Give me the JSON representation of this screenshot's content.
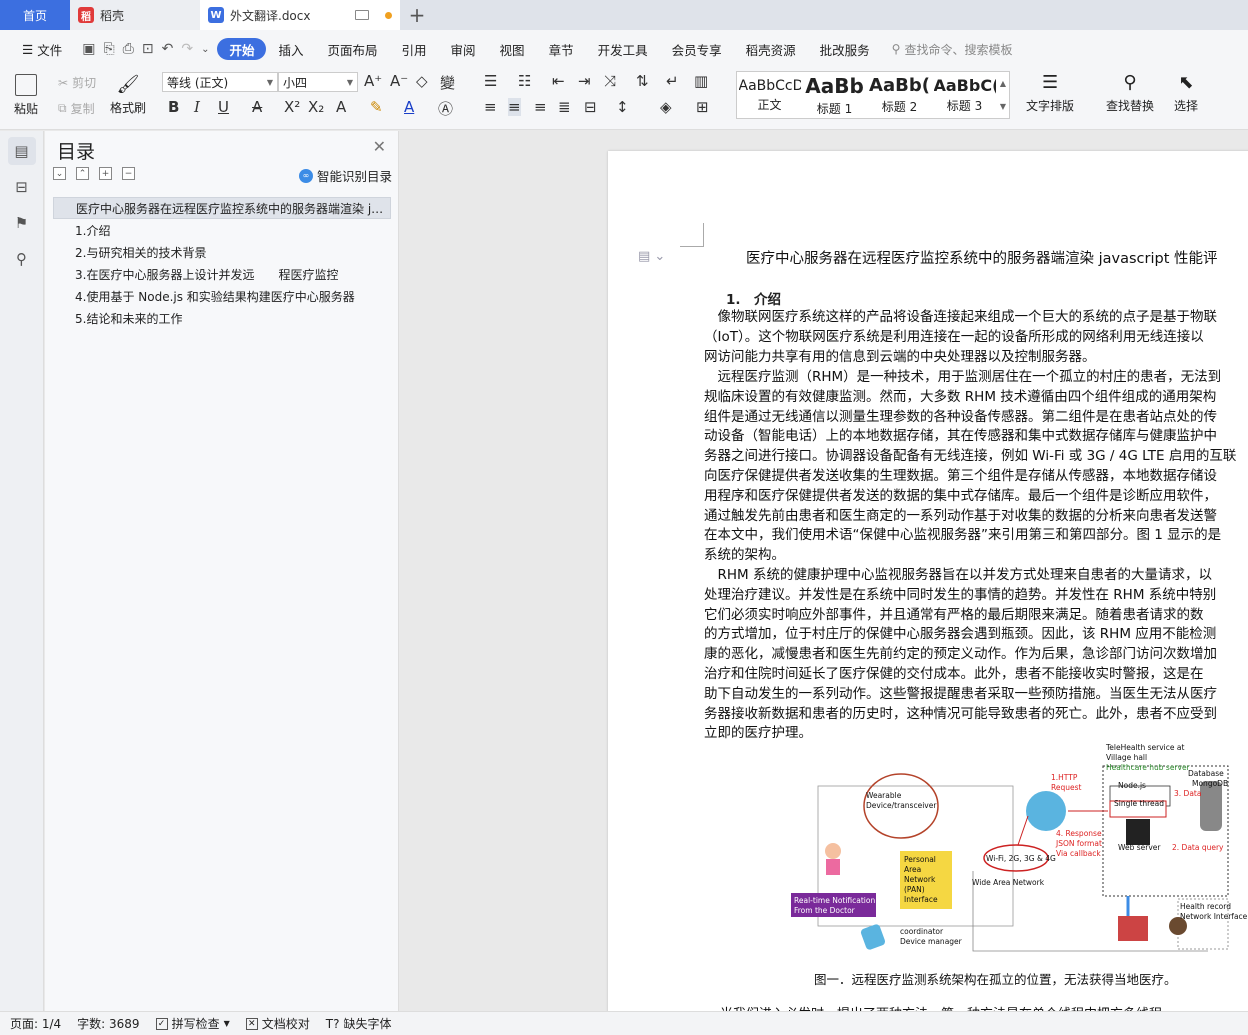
{
  "tabs": {
    "home": "首页",
    "daoke": "稻壳",
    "doc": "外文翻译.docx"
  },
  "menu": {
    "file": "文件",
    "items": [
      "开始",
      "插入",
      "页面布局",
      "引用",
      "审阅",
      "视图",
      "章节",
      "开发工具",
      "会员专享",
      "稻壳资源",
      "批改服务"
    ],
    "search": "查找命令、搜索模板"
  },
  "ribbon": {
    "paste": "粘贴",
    "cut": "剪切",
    "copy": "复制",
    "format_painter": "格式刷",
    "font": "等线 (正文)",
    "size": "小四",
    "styles": [
      {
        "preview": "AaBbCcD",
        "name": "正文"
      },
      {
        "preview": "AaBb",
        "name": "标题 1"
      },
      {
        "preview": "AaBb(",
        "name": "标题 2"
      },
      {
        "preview": "AaBbC(",
        "name": "标题 3"
      }
    ],
    "text_layout": "文字排版",
    "find_replace": "查找替换",
    "select": "选择"
  },
  "toc": {
    "title": "目录",
    "smart": "智能识别目录",
    "items": [
      "医疗中心服务器在远程医疗监控系统中的服务器端渲染 j…",
      "1.介绍",
      "2.与研究相关的技术背景",
      "3.在医疗中心服务器上设计并发远　　程医疗监控",
      "4.使用基于 Node.js 和实验结果构建医疗中心服务器",
      "5.结论和未来的工作"
    ]
  },
  "doc": {
    "title": "医疗中心服务器在远程医疗监控系统中的服务器端渲染 javascript 性能评",
    "heading": "1.　介绍",
    "p1": [
      "　像物联网医疗系统这样的产品将设备连接起来组成一个巨大的系统的点子是基于物联",
      "（IoT）。这个物联网医疗系统是利用连接在一起的设备所形成的网络利用无线连接以",
      "网访问能力共享有用的信息到云端的中央处理器以及控制服务器。"
    ],
    "p2": [
      "　远程医疗监测（RHM）是一种技术，用于监测居住在一个孤立的村庄的患者，无法到",
      "规临床设置的有效健康监测。然而，大多数 RHM 技术遵循由四个组件组成的通用架构",
      "组件是通过无线通信以测量生理参数的各种设备传感器。第二组件是在患者站点处的传",
      "动设备（智能电话）上的本地数据存储，其在传感器和集中式数据存储库与健康监护中",
      "务器之间进行接口。协调器设备配备有无线连接，例如 Wi-Fi 或 3G / 4G LTE 启用的互联",
      "向医疗保健提供者发送收集的生理数据。第三个组件是存储从传感器，本地数据存储设",
      "用程序和医疗保健提供者发送的数据的集中式存储库。最后一个组件是诊断应用软件，",
      "通过触发先前由患者和医生商定的一系列动作基于对收集的数据的分析来向患者发送警",
      "在本文中，我们使用术语“保健中心监视服务器”来引用第三和第四部分。图 1 显示的是",
      "系统的架构。"
    ],
    "p3": [
      "　RHM 系统的健康护理中心监视服务器旨在以并发方式处理来自患者的大量请求，以",
      "处理治疗建议。并发性是在系统中同时发生的事情的趋势。并发性在 RHM 系统中特别",
      "它们必须实时响应外部事件，并且通常有严格的最后期限来满足。随着患者请求的数",
      "的方式增加，位于村庄厅的保健中心服务器会遇到瓶颈。因此，该 RHM 应用不能检测",
      "康的恶化，减慢患者和医生先前约定的预定义动作。作为后果，急诊部门访问次数增加",
      "治疗和住院时间延长了医疗保健的交付成本。此外，患者不能接收实时警报，这是在",
      "助下自动发生的一系列动作。这些警报提醒患者采取一些预防措施。当医生无法从医疗",
      "务器接收新数据和患者的历史时，这种情况可能导致患者的死亡。此外，患者不应受到",
      "立即的医疗护理。"
    ],
    "figure": {
      "telehealth": "TeleHealth service at",
      "village": "Village hall",
      "hub": "Healthcare hub server",
      "database": "Database",
      "mongodb": "MongoDB",
      "nodejs": "Node.js",
      "single_thread": "Single thread",
      "web_server": "Web server",
      "data": "3. Data",
      "data_query": "2. Data query",
      "http1": "1.HTTP",
      "http2": "Request",
      "resp1": "4. Response",
      "resp2": "JSON format",
      "resp3": "Via callback",
      "wearable1": "Wearable",
      "wearable2": "Device/transceiver",
      "wifi": "Wi-Fi, 2G, 3G & 4G",
      "wan": "Wide Area Network",
      "pan": [
        "Personal",
        "Area",
        "Network",
        "(PAN)",
        "Interface"
      ],
      "notif1": "Real-time Notification",
      "notif2": "From the Doctor",
      "coord1": "coordinator",
      "coord2": "Device manager",
      "hr1": "Health record",
      "hr2": "Network Interface"
    },
    "caption": "图一．远程医疗监测系统架构在孤立的位置，无法获得当地医疗。",
    "last_line": "当我们进入必发时，提出了两种方法，第一种方法是在单个线程中把方多线程，"
  },
  "status": {
    "page": "页面: 1/4",
    "words": "字数: 3689",
    "spell": "拼写检查",
    "proof": "文档校对",
    "missing_font": "缺失字体"
  },
  "colors": {
    "accent": "#3c6fe0",
    "wps_red": "#e03a3a"
  }
}
